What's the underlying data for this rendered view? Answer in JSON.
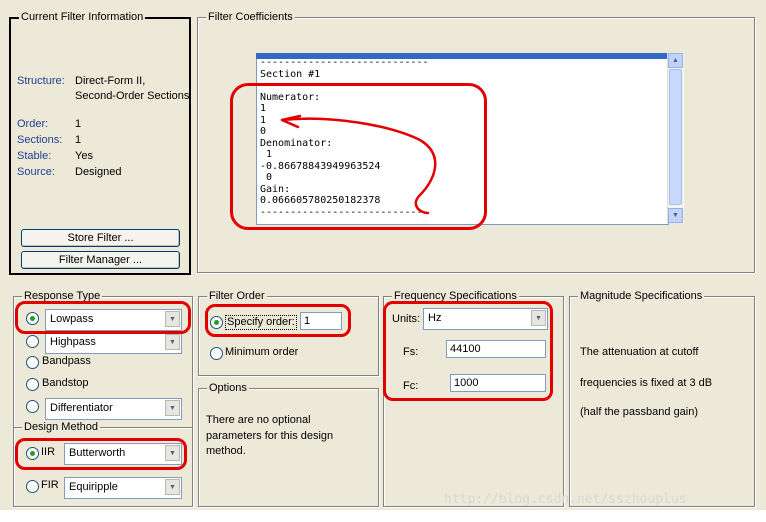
{
  "current_filter": {
    "legend": "Current Filter Information",
    "structure_label": "Structure:",
    "structure_value_1": "Direct-Form II,",
    "structure_value_2": "Second-Order Sections",
    "order_label": "Order:",
    "order_value": "1",
    "sections_label": "Sections:",
    "sections_value": "1",
    "stable_label": "Stable:",
    "stable_value": "Yes",
    "source_label": "Source:",
    "source_value": "Designed",
    "store_button": "Store Filter ...",
    "manager_button": "Filter Manager ..."
  },
  "coefficients": {
    "legend": "Filter Coefficients",
    "lines": [
      "----------------------------",
      "Section #1",
      "----------------------------",
      "Numerator:",
      "1",
      "1",
      "0",
      "Denominator:",
      " 1",
      "-0.86678843949963524",
      " 0",
      "Gain:",
      "0.066605780250182378",
      "----------------------------"
    ]
  },
  "response_type": {
    "legend": "Response Type",
    "lowpass": "Lowpass",
    "highpass": "Highpass",
    "bandpass": "Bandpass",
    "bandstop": "Bandstop",
    "differentiator": "Differentiator",
    "selected": "Lowpass"
  },
  "design_method": {
    "legend": "Design Method",
    "iir_label": "IIR",
    "iir_value": "Butterworth",
    "fir_label": "FIR",
    "fir_value": "Equiripple",
    "selected": "IIR"
  },
  "filter_order": {
    "legend": "Filter Order",
    "specify_label": "Specify order:",
    "specify_value": "1",
    "minimum_label": "Minimum order",
    "selected": "specify"
  },
  "options": {
    "legend": "Options",
    "text_1": "There are no optional",
    "text_2": "parameters for this design",
    "text_3": "method."
  },
  "frequency": {
    "legend": "Frequency Specifications",
    "units_label": "Units:",
    "units_value": "Hz",
    "fs_label": "Fs:",
    "fs_value": "44100",
    "fc_label": "Fc:",
    "fc_value": "1000"
  },
  "magnitude": {
    "legend": "Magnitude Specifications",
    "line_1": "The attenuation at cutoff",
    "line_2": "frequencies is fixed at 3 dB",
    "line_3": "(half the passband gain)"
  },
  "watermark": "http://blog.csdn.net/sszhouplus",
  "colors": {
    "panel": "#ece9d8",
    "annotation_red": "#e30000",
    "radio_selected": "#21a121"
  },
  "icons": [
    "scroll-up-icon",
    "scroll-down-icon",
    "dropdown-arrow-icon",
    "hand-drawn-arrow-annotation"
  ]
}
